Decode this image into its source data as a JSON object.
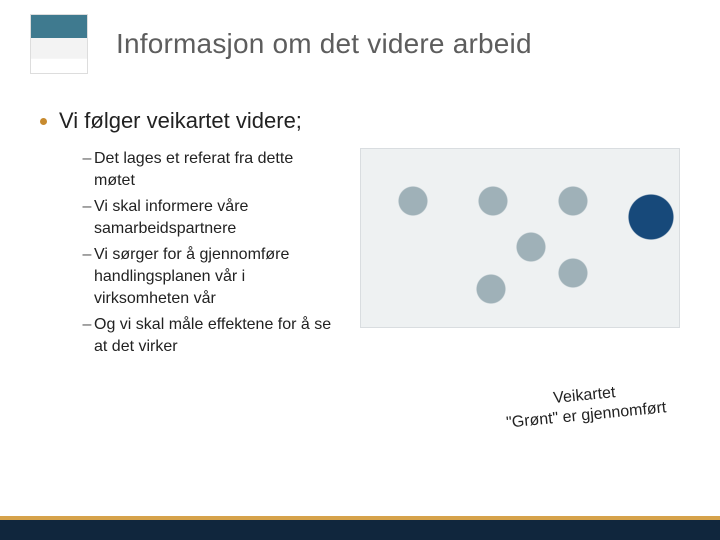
{
  "title": "Informasjon om det videre arbeid",
  "lead": "Vi følger veikartet videre;",
  "subs": [
    "Det lages et referat fra dette møtet",
    "Vi skal informere våre samarbeidspartnere",
    "Vi sørger for å gjennomføre handlingsplanen vår i virksomheten vår",
    "Og vi skal måle effektene for å se at det virker"
  ],
  "callout_line1": "Veikartet",
  "callout_line2": "\"Grønt\" er gjennomført"
}
